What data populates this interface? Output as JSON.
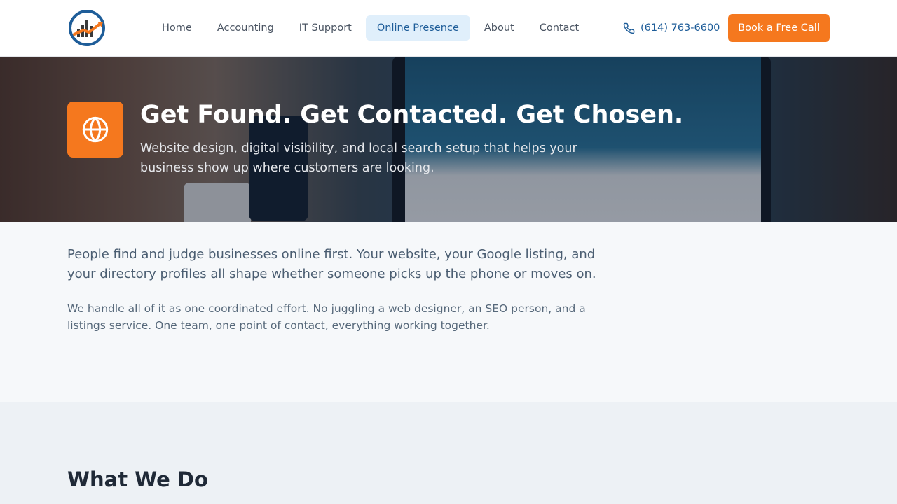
{
  "header": {
    "logo_icon": "bar-chart-growth-logo",
    "nav": [
      {
        "label": "Home",
        "active": false
      },
      {
        "label": "Accounting",
        "active": false
      },
      {
        "label": "IT Support",
        "active": false
      },
      {
        "label": "Online Presence",
        "active": true
      },
      {
        "label": "About",
        "active": false
      },
      {
        "label": "Contact",
        "active": false
      }
    ],
    "phone": "(614) 763-6600",
    "cta_label": "Book a Free Call"
  },
  "hero": {
    "icon": "globe-icon",
    "title": "Get Found. Get Contacted. Get Chosen.",
    "subtitle": "Website design, digital visibility, and local search setup that helps your business show up where customers are looking."
  },
  "intro": {
    "lead": "People find and judge businesses online first. Your website, your Google listing, and your directory profiles all shape whether someone picks up the phone or moves on.",
    "body": "We handle all of it as one coordinated effort. No juggling a web designer, an SEO person, and a listings service. One team, one point of contact, everything working together."
  },
  "services": {
    "title": "What We Do"
  },
  "colors": {
    "accent": "#f5781e",
    "brand_blue": "#1e5d99",
    "nav_active_bg": "#e0effb"
  }
}
